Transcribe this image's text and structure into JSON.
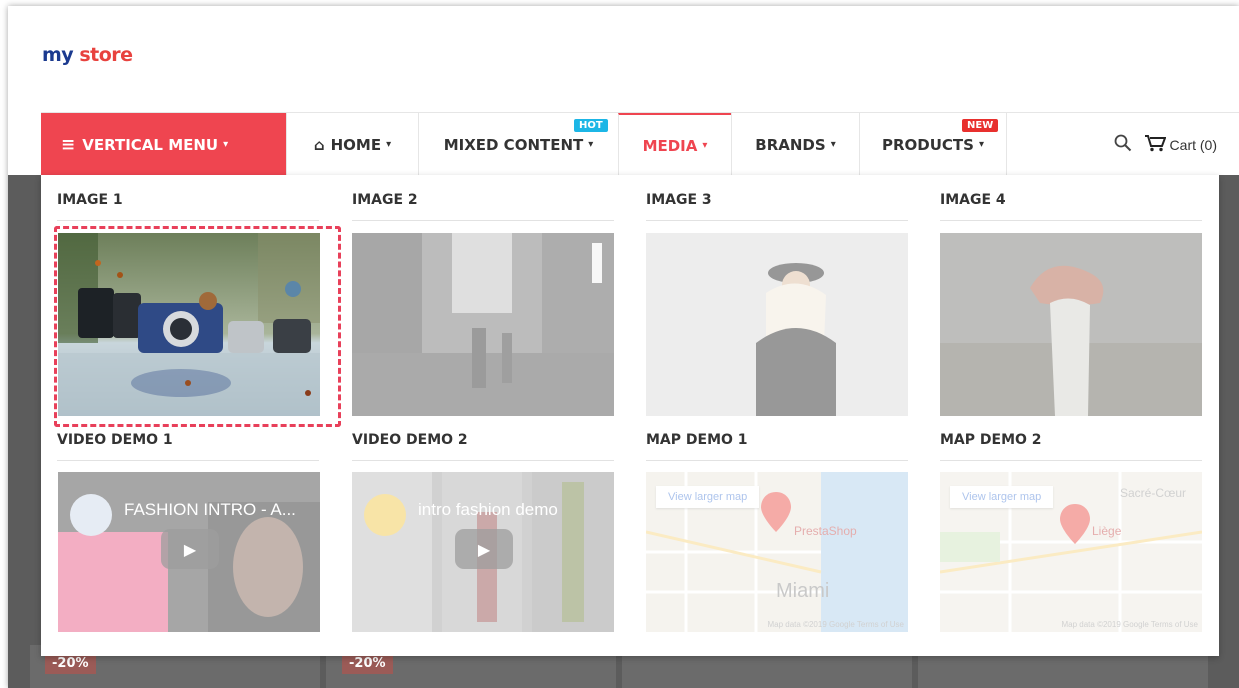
{
  "header": {
    "logo_part1": "my",
    "logo_part2": "store"
  },
  "nav": {
    "vertical_menu": "VERTICAL MENU",
    "items": [
      {
        "label": "HOME"
      },
      {
        "label": "MIXED CONTENT",
        "badge": "HOT"
      },
      {
        "label": "MEDIA"
      },
      {
        "label": "BRANDS"
      },
      {
        "label": "PRODUCTS",
        "badge": "NEW"
      }
    ],
    "cart_label": "Cart (0)"
  },
  "dropdown": {
    "columns": [
      {
        "title": "IMAGE 1"
      },
      {
        "title": "IMAGE 2"
      },
      {
        "title": "IMAGE 3"
      },
      {
        "title": "IMAGE 4"
      },
      {
        "title": "VIDEO DEMO 1",
        "video_title": "FASHION INTRO - A..."
      },
      {
        "title": "VIDEO DEMO 2",
        "video_title": "intro fashion demo"
      },
      {
        "title": "MAP DEMO 1",
        "map_button": "View larger map",
        "place": "PrestaShop",
        "city": "Miami",
        "footer": "Map data ©2019 Google   Terms of Use"
      },
      {
        "title": "MAP DEMO 2",
        "map_button": "View larger map",
        "place": "Liège",
        "city": "Sacré-Cœur",
        "footer": "Map data ©2019 Google   Terms of Use"
      }
    ]
  },
  "products": {
    "discount1": "-20%",
    "discount2": "-20%"
  },
  "colors": {
    "accent": "#ef4550",
    "hot": "#1cb6e6",
    "new": "#e8302e"
  }
}
